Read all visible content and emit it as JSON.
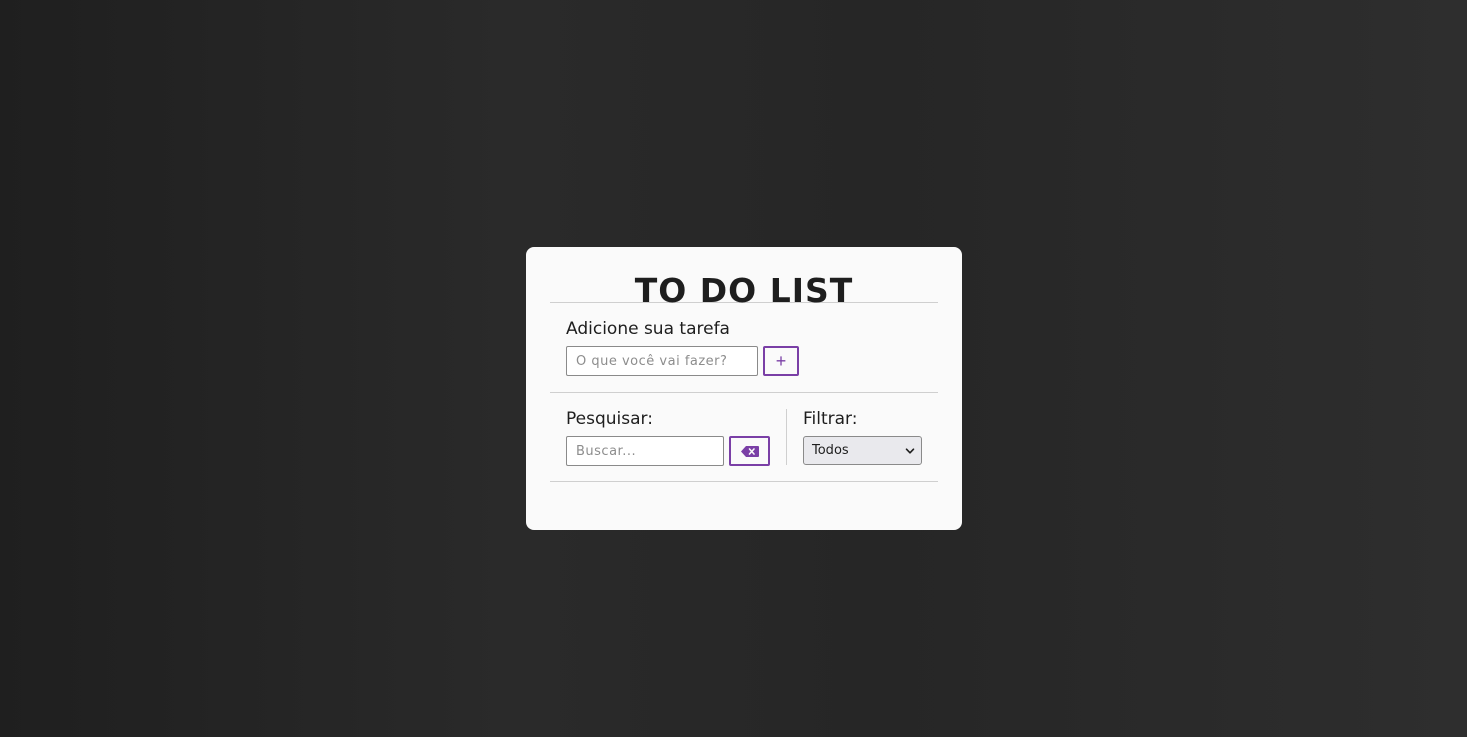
{
  "app": {
    "title": "TO DO LIST"
  },
  "add_task": {
    "label": "Adicione sua tarefa",
    "placeholder": "O que você vai fazer?",
    "value": "",
    "button_icon": "plus-icon",
    "button_glyph": "+"
  },
  "search": {
    "label": "Pesquisar:",
    "placeholder": "Buscar...",
    "value": "",
    "button_icon": "backspace-icon"
  },
  "filter": {
    "label": "Filtrar:",
    "selected": "Todos",
    "icon": "chevron-down-icon"
  },
  "colors": {
    "accent": "#7a3fa6",
    "card_background": "#fafafa",
    "page_background": "#262626"
  }
}
